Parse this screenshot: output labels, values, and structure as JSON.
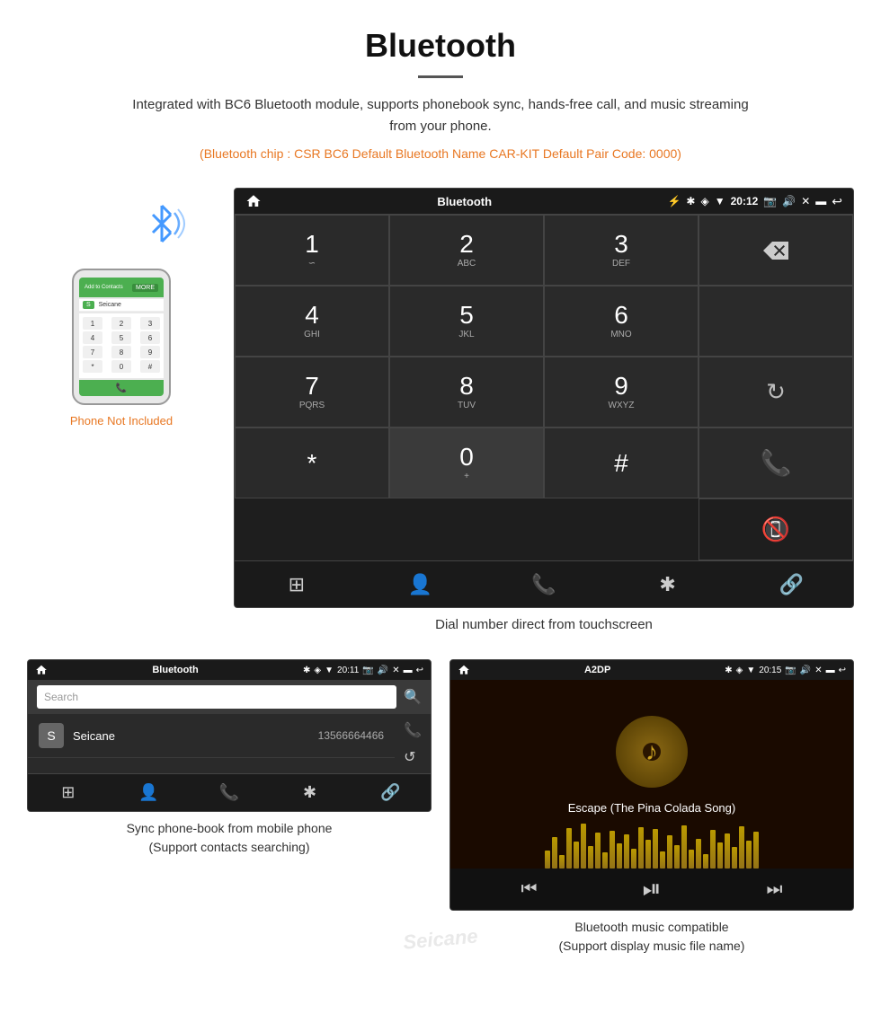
{
  "page": {
    "title": "Bluetooth",
    "divider": true,
    "description": "Integrated with BC6 Bluetooth module, supports phonebook sync, hands-free call, and music streaming from your phone.",
    "specs": "(Bluetooth chip : CSR BC6   Default Bluetooth Name CAR-KIT   Default Pair Code: 0000)"
  },
  "dialer_screen": {
    "status_bar": {
      "app_name": "Bluetooth",
      "time": "20:12",
      "usb_icon": "⚡",
      "bt_icon": "✱",
      "location_icon": "◈",
      "wifi_icon": "▼",
      "camera_icon": "📷",
      "volume_icon": "🔊",
      "close_icon": "✕",
      "window_icon": "▬",
      "back_icon": "↩"
    },
    "keys": [
      {
        "num": "1",
        "sub": "∽"
      },
      {
        "num": "2",
        "sub": "ABC"
      },
      {
        "num": "3",
        "sub": "DEF"
      },
      {
        "num": "",
        "sub": "",
        "type": "backspace"
      },
      {
        "num": "4",
        "sub": "GHI"
      },
      {
        "num": "5",
        "sub": "JKL"
      },
      {
        "num": "6",
        "sub": "MNO"
      },
      {
        "num": "",
        "sub": "",
        "type": "empty"
      },
      {
        "num": "7",
        "sub": "PQRS"
      },
      {
        "num": "8",
        "sub": "TUV"
      },
      {
        "num": "9",
        "sub": "WXYZ"
      },
      {
        "num": "",
        "sub": "",
        "type": "refresh"
      },
      {
        "num": "*",
        "sub": ""
      },
      {
        "num": "0",
        "sub": "+"
      },
      {
        "num": "#",
        "sub": ""
      },
      {
        "num": "",
        "sub": "",
        "type": "call-green"
      },
      {
        "num": "",
        "sub": "",
        "type": "empty"
      },
      {
        "num": "",
        "sub": "",
        "type": "empty"
      },
      {
        "num": "",
        "sub": "",
        "type": "empty"
      },
      {
        "num": "",
        "sub": "",
        "type": "call-red"
      }
    ],
    "bottom_nav": [
      "⊞",
      "👤",
      "📞",
      "✱",
      "🔗"
    ],
    "caption": "Dial number direct from touchscreen"
  },
  "phone_mockup": {
    "top_bar_text": "Add to Contacts",
    "more_btn": "MORE",
    "contact_name": "S",
    "dial_keys": [
      [
        "1",
        "2",
        "3"
      ],
      [
        "4",
        "5",
        "6"
      ],
      [
        "7",
        "8",
        "9"
      ],
      [
        "*",
        "0",
        "#"
      ]
    ],
    "phone_not_included": "Phone Not Included"
  },
  "phonebook_screen": {
    "status_bar": {
      "app_name": "Bluetooth",
      "time": "20:11"
    },
    "search_placeholder": "Search",
    "contact": {
      "initial": "S",
      "name": "Seicane",
      "phone": "13566664466"
    },
    "right_icons": [
      "📞",
      "↺"
    ],
    "bottom_nav": [
      "⊞",
      "👤",
      "📞",
      "✱",
      "🔗"
    ],
    "caption_line1": "Sync phone-book from mobile phone",
    "caption_line2": "(Support contacts searching)"
  },
  "music_screen": {
    "status_bar": {
      "app_name": "A2DP",
      "time": "20:15"
    },
    "song_title": "Escape (The Pina Colada Song)",
    "bars": [
      20,
      35,
      15,
      45,
      30,
      50,
      25,
      40,
      18,
      42,
      28,
      38,
      22,
      46,
      32,
      44,
      19,
      37,
      26,
      48,
      21,
      33,
      16,
      43,
      29,
      39,
      24,
      47,
      31,
      41
    ],
    "controls": [
      "⏮",
      "⏭"
    ],
    "play_pause": "⏯",
    "caption_line1": "Bluetooth music compatible",
    "caption_line2": "(Support display music file name)"
  },
  "bluetooth_icon": {
    "color": "#4499ff"
  },
  "watermark": "Seicane"
}
